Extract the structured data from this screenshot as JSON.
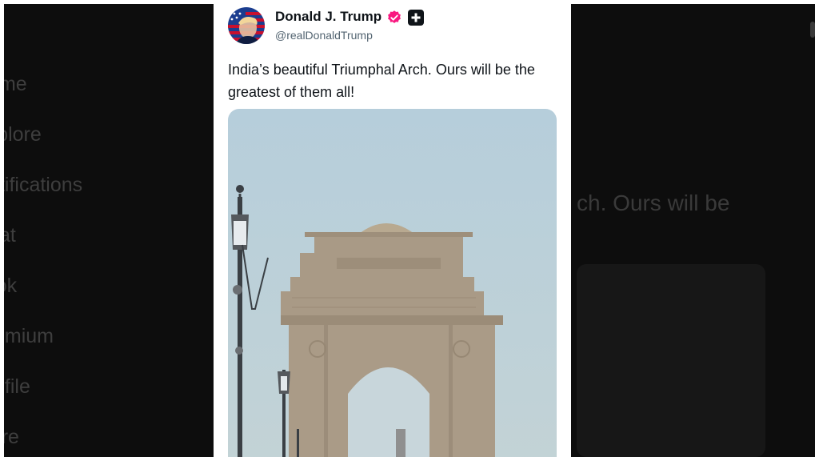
{
  "background": {
    "nav_items": [
      "Home",
      "Explore",
      "Notifications",
      "Chat",
      "Grok",
      "Premium",
      "Profile",
      "More"
    ],
    "post_text_fragment": "ch. Ours will be"
  },
  "post": {
    "display_name": "Donald J. Trump",
    "handle": "@realDonaldTrump",
    "text": "India’s beautiful Triumphal Arch. Ours will be the greatest of them all!",
    "image_subject": "India Gate, New Delhi",
    "verified_icon": "verified-badge-icon",
    "affiliation_icon": "plus-badge-icon"
  },
  "colors": {
    "verified_badge": "#f91880",
    "sky": "#b7cfd9",
    "stone": "#a99a86",
    "backdrop": "#0d0d0d"
  }
}
